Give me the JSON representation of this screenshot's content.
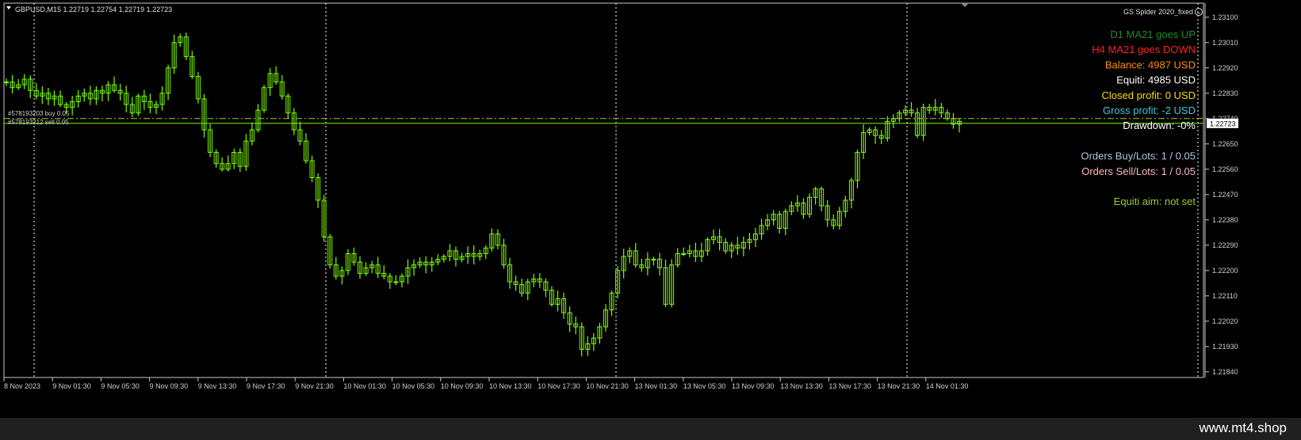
{
  "header": {
    "symbol_line": "GBPUSD,M15  1.22719 1.22754 1.22719 1.22723",
    "indicator_name": "GS Spider 2020_fixed"
  },
  "panel": {
    "lines": [
      {
        "text": "D1 MA21 goes UP",
        "color": "#228b22"
      },
      {
        "text": "H4 MA21 goes DOWN",
        "color": "#ff2020"
      },
      {
        "text": "Balance: 4987 USD",
        "color": "#ff8c00"
      },
      {
        "text": "Equiti: 4985 USD",
        "color": "#ffffff"
      },
      {
        "text": "Closed profit: 0 USD",
        "color": "#ffd700"
      },
      {
        "text": "Gross profit: -2 USD",
        "color": "#40c8e0"
      },
      {
        "text": "Drawdown: -0%",
        "color": "#ffffff"
      },
      {
        "text": "",
        "color": "#ffffff"
      },
      {
        "text": "Orders Buy/Lots: 1 / 0.05",
        "color": "#b0c4de"
      },
      {
        "text": "Orders Sell/Lots: 1 / 0.05",
        "color": "#ffb6c1"
      },
      {
        "text": "",
        "color": "#ffffff"
      },
      {
        "text": "Equiti aim: not set",
        "color": "#9acd32"
      }
    ]
  },
  "order_labels": [
    "#578193203 buy 0.05",
    "#578193212 sell 0.05"
  ],
  "footer": {
    "brand": "www.mt4.shop"
  },
  "colors": {
    "background": "#000000",
    "candle": "#7cfc00",
    "grid": "#ffffff",
    "order_line": "#9acd32",
    "price_line": "#7cfc00",
    "price_tag_bg": "#ffffff",
    "price_tag_text": "#000000"
  },
  "chart_data": {
    "type": "line",
    "title": "GBPUSD,M15",
    "ylim": [
      1.2182,
      1.2315
    ],
    "price_ticks": [
      "1.23100",
      "1.23010",
      "1.22920",
      "1.22830",
      "1.22740",
      "1.22650",
      "1.22560",
      "1.22470",
      "1.22380",
      "1.22290",
      "1.22200",
      "1.22110",
      "1.22020",
      "1.21930",
      "1.21840"
    ],
    "time_labels": [
      "8 Nov 2023",
      "9 Nov 01:30",
      "9 Nov 05:30",
      "9 Nov 09:30",
      "9 Nov 13:30",
      "9 Nov 17:30",
      "9 Nov 21:30",
      "10 Nov 01:30",
      "10 Nov 05:30",
      "10 Nov 09:30",
      "10 Nov 13:30",
      "10 Nov 17:30",
      "10 Nov 21:30",
      "13 Nov 01:30",
      "13 Nov 05:30",
      "13 Nov 09:30",
      "13 Nov 13:30",
      "13 Nov 17:30",
      "13 Nov 21:30",
      "14 Nov 01:30"
    ],
    "current_price": "1.22723",
    "current_price_value": 1.22723,
    "order_buy_price": 1.2274,
    "order_sell_price": 1.22725,
    "close_series": [
      1.2287,
      1.2285,
      1.2286,
      1.2288,
      1.2284,
      1.2282,
      1.2283,
      1.2281,
      1.2282,
      1.2279,
      1.2278,
      1.228,
      1.2282,
      1.2283,
      1.2281,
      1.2284,
      1.2283,
      1.2286,
      1.2284,
      1.2283,
      1.2279,
      1.2276,
      1.2282,
      1.228,
      1.2278,
      1.2279,
      1.2283,
      1.2292,
      1.2301,
      1.2303,
      1.2296,
      1.2289,
      1.2281,
      1.227,
      1.2262,
      1.2258,
      1.2256,
      1.2258,
      1.2262,
      1.2257,
      1.2266,
      1.227,
      1.2277,
      1.2285,
      1.229,
      1.2287,
      1.2282,
      1.2276,
      1.227,
      1.2266,
      1.2259,
      1.2253,
      1.2245,
      1.2232,
      1.2222,
      1.2218,
      1.222,
      1.2226,
      1.2223,
      1.2219,
      1.2221,
      1.2222,
      1.2219,
      1.2218,
      1.2216,
      1.2216,
      1.2218,
      1.2221,
      1.2222,
      1.2223,
      1.2222,
      1.2223,
      1.2224,
      1.2225,
      1.2227,
      1.2224,
      1.2225,
      1.2226,
      1.2225,
      1.2226,
      1.2228,
      1.2233,
      1.2229,
      1.2222,
      1.2216,
      1.2215,
      1.2212,
      1.2216,
      1.2217,
      1.2216,
      1.2213,
      1.2208,
      1.221,
      1.2205,
      1.2201,
      1.22,
      1.2192,
      1.2194,
      1.2196,
      1.22,
      1.2206,
      1.2212,
      1.222,
      1.2225,
      1.2227,
      1.2222,
      1.2221,
      1.2224,
      1.2224,
      1.2221,
      1.2208,
      1.2222,
      1.2226,
      1.2226,
      1.2227,
      1.2225,
      1.2227,
      1.2231,
      1.2232,
      1.223,
      1.2227,
      1.2229,
      1.2228,
      1.223,
      1.2231,
      1.2233,
      1.2236,
      1.2238,
      1.224,
      1.2235,
      1.2241,
      1.2243,
      1.2244,
      1.224,
      1.2246,
      1.2249,
      1.2243,
      1.2238,
      1.2236,
      1.2241,
      1.2245,
      1.2252,
      1.2262,
      1.2269,
      1.227,
      1.2268,
      1.2267,
      1.2273,
      1.2274,
      1.2276,
      1.2277,
      1.2276,
      1.2268,
      1.2278,
      1.2277,
      1.2278,
      1.2276,
      1.2274,
      1.2272,
      1.2273
    ]
  }
}
